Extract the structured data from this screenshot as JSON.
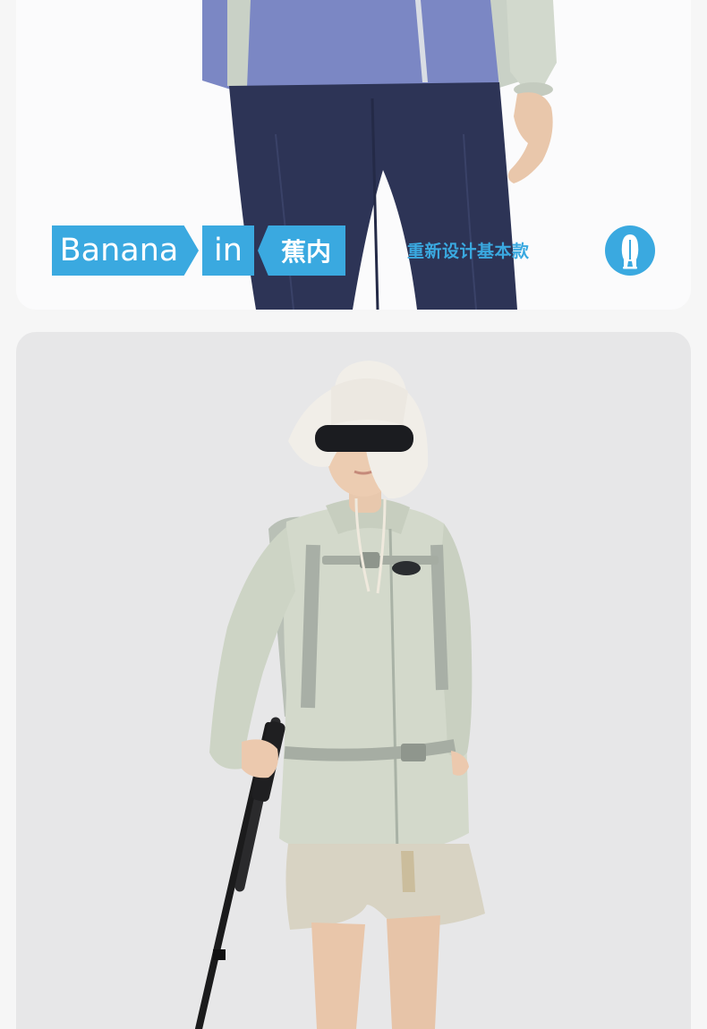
{
  "banner": {
    "brand_word": "Banana",
    "connector_word": "in",
    "chinese_brand": "蕉内",
    "slogan": "重新设计基本款",
    "logo_icon": "bananain-figure-icon",
    "accent_color": "#3aa9e0"
  },
  "photo": {
    "subject": "model-outdoor-outfit",
    "background_color": "#e7e7e8"
  }
}
